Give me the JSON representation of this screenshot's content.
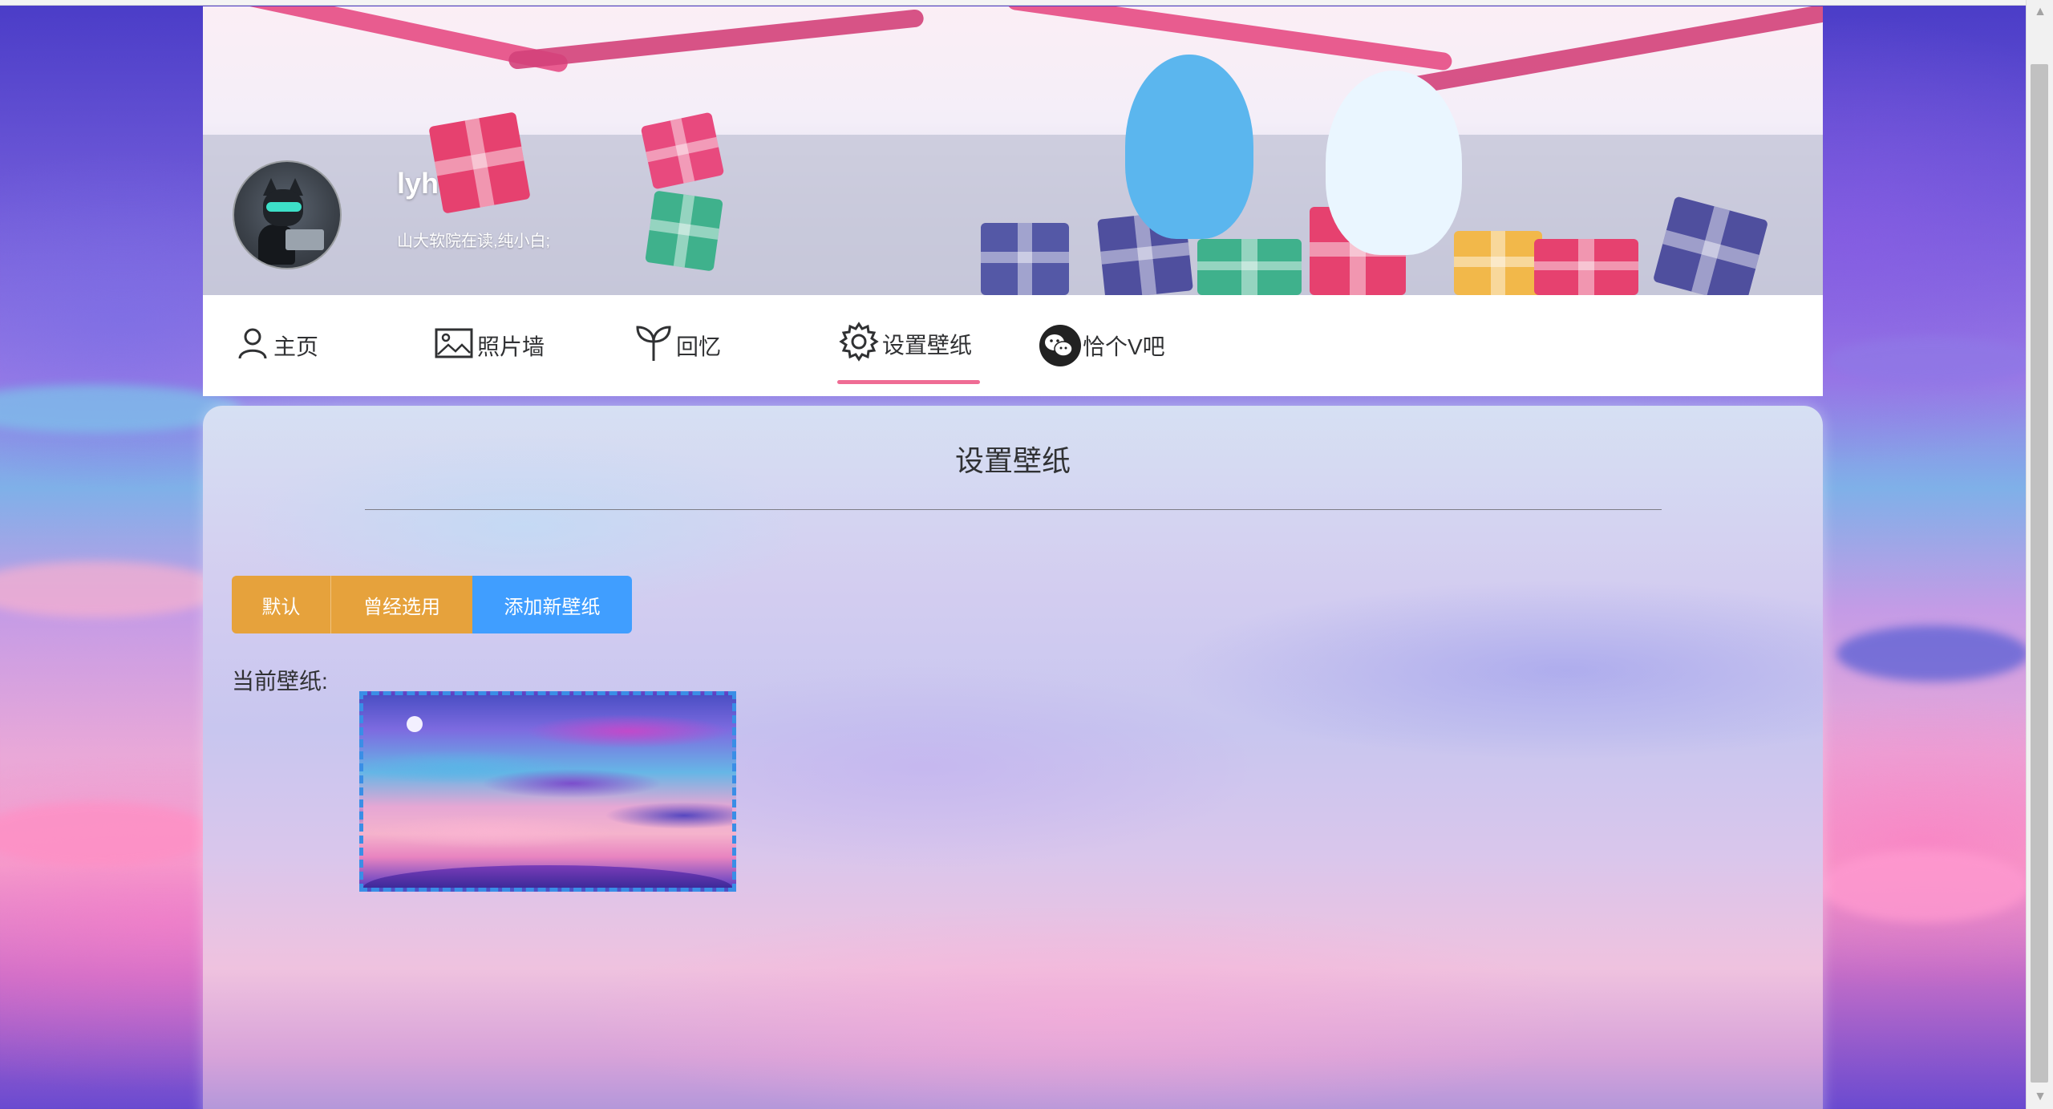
{
  "user": {
    "name": "lyh",
    "bio": "山大软院在读,纯小白;"
  },
  "nav": {
    "items": [
      {
        "label": "主页",
        "icon": "user-icon"
      },
      {
        "label": "照片墙",
        "icon": "image-icon"
      },
      {
        "label": "回忆",
        "icon": "sprout-icon"
      },
      {
        "label": "设置壁纸",
        "icon": "gear-icon",
        "active": true
      },
      {
        "label": "恰个V吧",
        "icon": "wechat-icon"
      }
    ]
  },
  "panel": {
    "title": "设置壁纸",
    "buttons": {
      "default_label": "默认",
      "used_label": "曾经选用",
      "add_label": "添加新壁纸"
    },
    "current_label": "当前壁纸:"
  },
  "colors": {
    "warning": "#e6a23c",
    "primary": "#409eff",
    "active_underline": "#ef6c94"
  }
}
